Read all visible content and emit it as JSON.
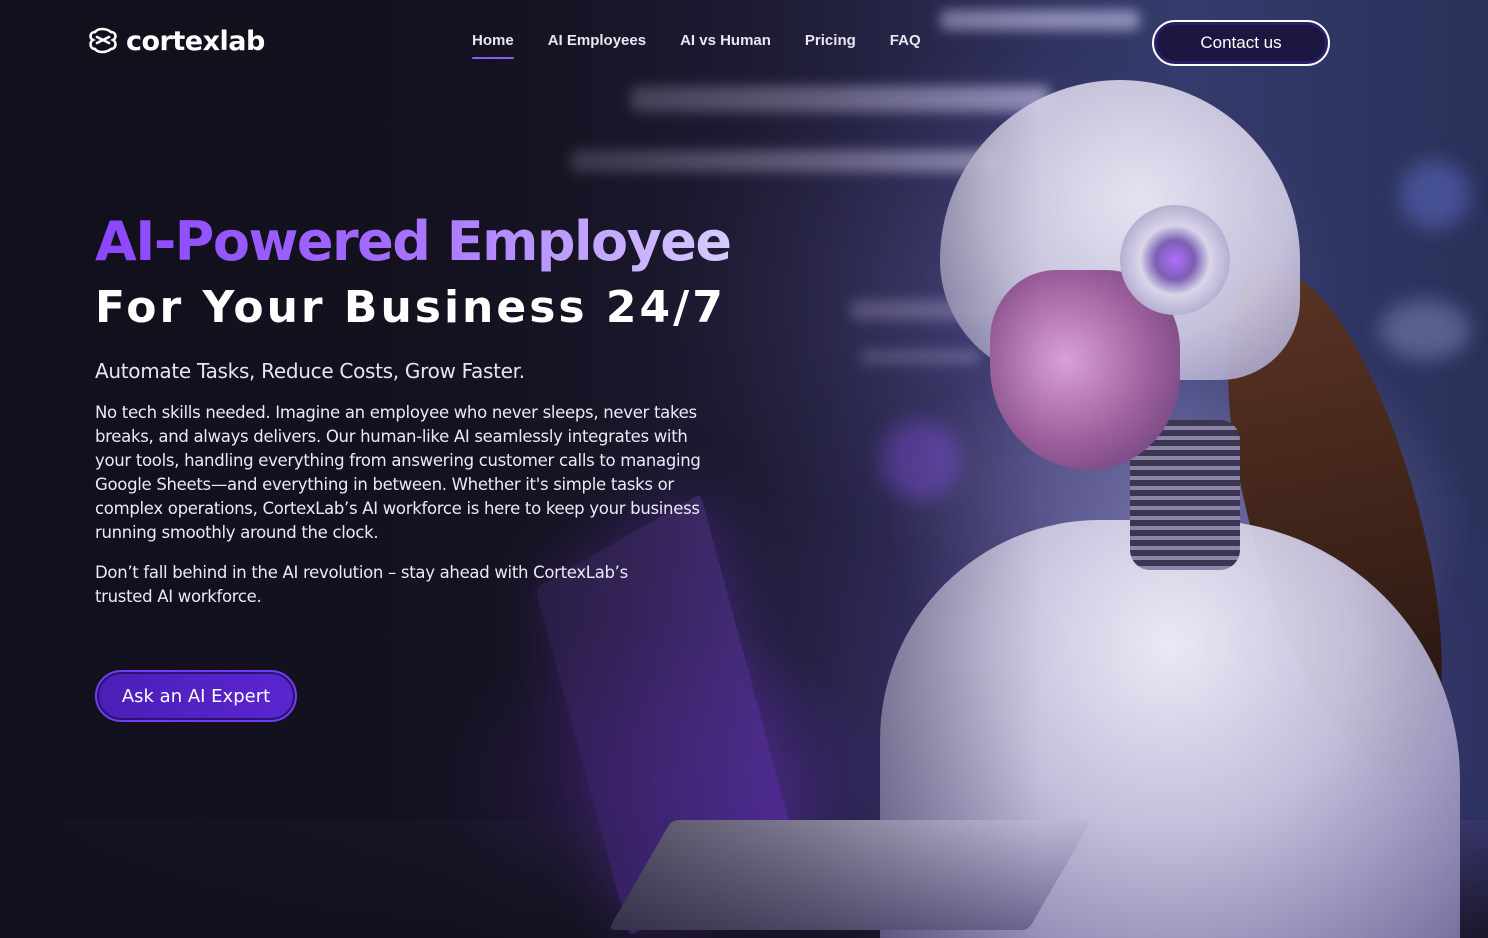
{
  "brand": {
    "name": "cortexlab",
    "logo_icon": "brain-icon"
  },
  "nav": {
    "items": [
      {
        "label": "Home",
        "active": true
      },
      {
        "label": "AI Employees",
        "active": false
      },
      {
        "label": "AI vs Human",
        "active": false
      },
      {
        "label": "Pricing",
        "active": false
      },
      {
        "label": "FAQ",
        "active": false
      }
    ],
    "contact_label": "Contact us"
  },
  "hero": {
    "title": "AI-Powered Employee",
    "subtitle": "For Your Business 24/7",
    "tagline": "Automate Tasks, Reduce Costs, Grow Faster.",
    "body": "No tech skills needed. Imagine an employee who never sleeps, never takes breaks, and always delivers. Our human-like AI seamlessly integrates with your tools, handling everything from answering customer calls to managing Google Sheets—and everything in between. Whether it's simple tasks or complex operations, CortexLab’s AI workforce is here to keep your business running smoothly around the clock.",
    "body2": "Don’t fall behind in the AI revolution – stay ahead with CortexLab’s trusted AI workforce.",
    "cta_label": "Ask an AI Expert"
  },
  "colors": {
    "accent": "#8b5cf6",
    "title_gradient_start": "#8b45ff",
    "title_gradient_end": "#d8ccff",
    "cta_background": "#4b1fb8",
    "page_background": "#14121f"
  }
}
